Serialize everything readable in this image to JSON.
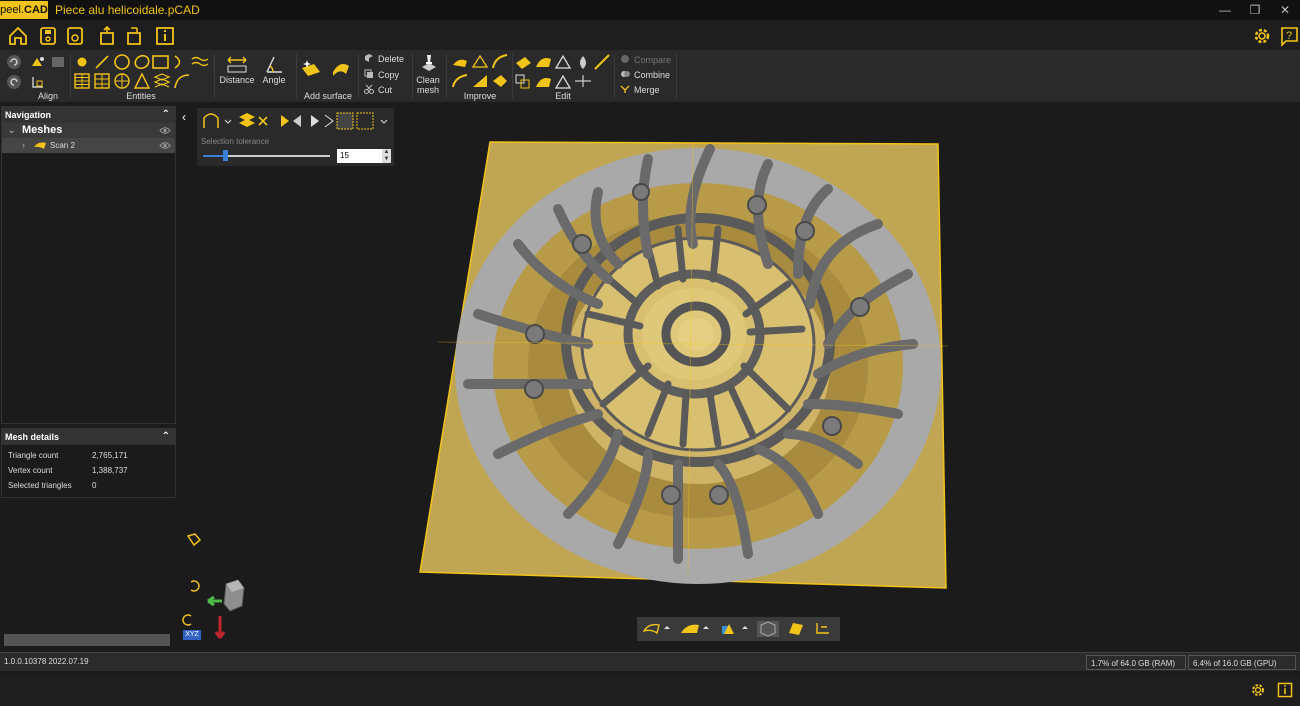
{
  "app": {
    "logo_text": "peel.",
    "logo_suffix": "CAD",
    "document_title": "Piece alu helicoidale.pCAD",
    "accent_color": "#f2c318"
  },
  "window_controls": [
    "minimize-icon",
    "restore-icon",
    "close-icon"
  ],
  "quick_toolbar": [
    "home-icon",
    "save-icon",
    "save-as-icon",
    "import-icon",
    "export-icon",
    "info-icon"
  ],
  "ribbon": {
    "groups": [
      {
        "label": "Align"
      },
      {
        "label": "Entities"
      },
      {
        "label": "Distance"
      },
      {
        "label": "Angle"
      },
      {
        "label": "Add surface"
      },
      {
        "label": "Improve"
      },
      {
        "label": "Edit"
      }
    ],
    "commands": {
      "delete": "Delete",
      "copy": "Copy",
      "cut": "Cut",
      "clean_mesh_line1": "Clean",
      "clean_mesh_line2": "mesh",
      "compare": "Compare",
      "combine": "Combine",
      "merge": "Merge"
    }
  },
  "navigation": {
    "title": "Navigation",
    "group": "Meshes",
    "items": [
      {
        "label": "Scan 2"
      }
    ]
  },
  "mesh_details": {
    "title": "Mesh details",
    "rows": [
      {
        "label": "Triangle count",
        "value": "2,765,171"
      },
      {
        "label": "Vertex count",
        "value": "1,388,737"
      },
      {
        "label": "Selected triangles",
        "value": "0"
      }
    ]
  },
  "selection_panel": {
    "tolerance_label": "Selection tolerance",
    "tolerance_value": "15",
    "slider_fraction": 0.17
  },
  "axes_label": "XYZ",
  "status": {
    "version": "1.0.0.10378 2022.07.19",
    "ram": "1.7% of 64.0 GB (RAM)",
    "gpu": "6.4% of 16.0 GB (GPU)"
  }
}
